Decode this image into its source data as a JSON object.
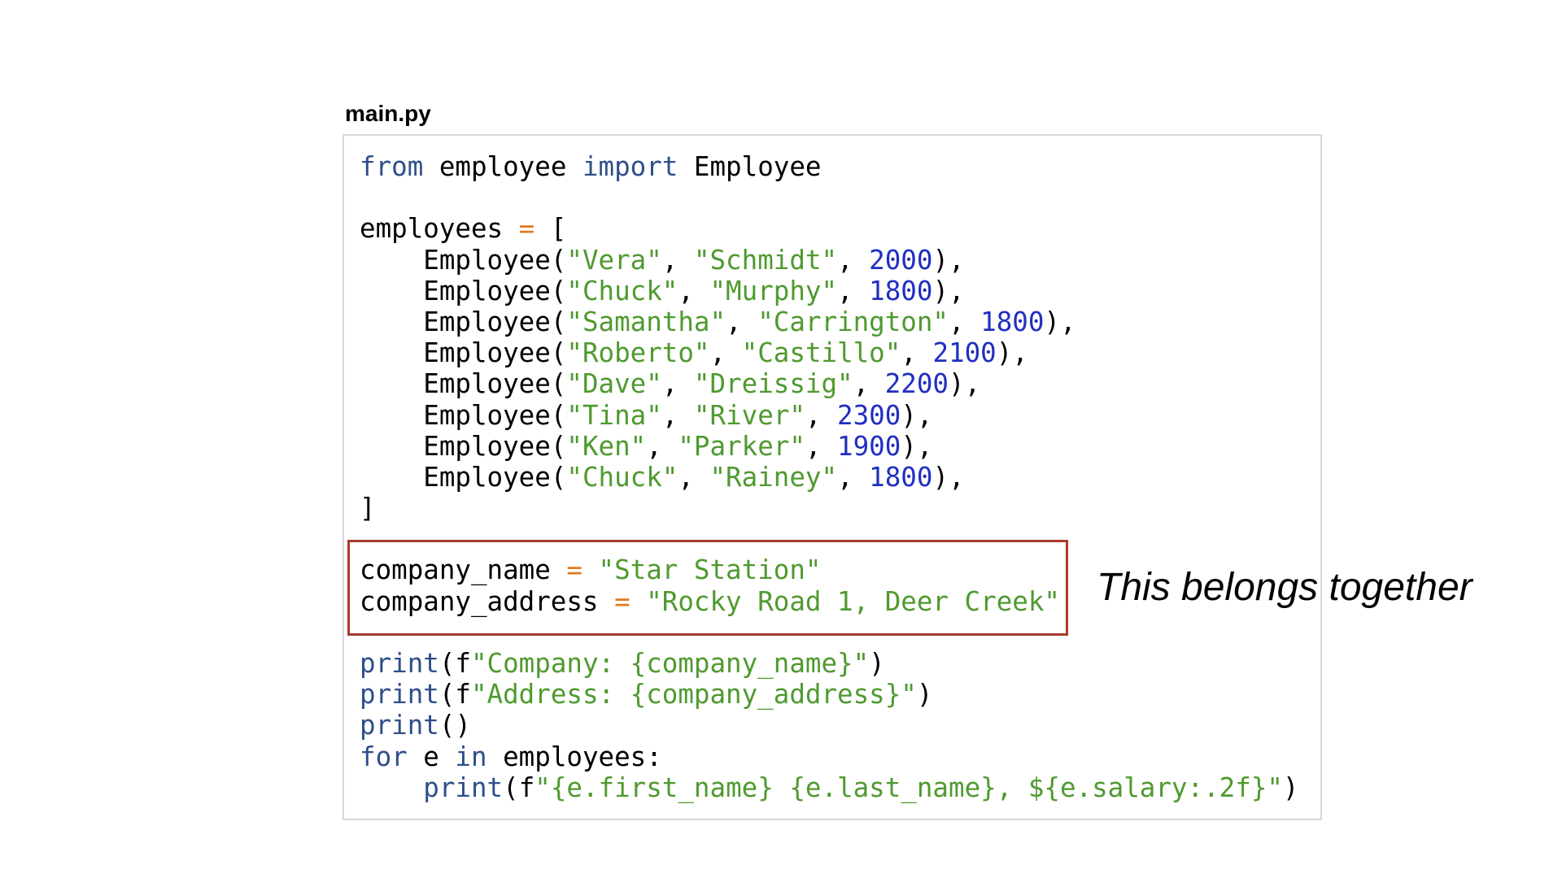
{
  "file_title": "main.py",
  "annotation": "This belongs together",
  "colors": {
    "keyword": "#2f4f8a",
    "string": "#4f9a2f",
    "number": "#1f2fc0",
    "operator": "#e07b1f",
    "highlight_border": "#a83a2c",
    "panel_border": "#d9d9d9"
  },
  "code_lines": [
    [
      [
        "kw",
        "from"
      ],
      [
        "id",
        " employee "
      ],
      [
        "kw",
        "import"
      ],
      [
        "id",
        " Employee"
      ]
    ],
    [],
    [
      [
        "id",
        "employees "
      ],
      [
        "op",
        "="
      ],
      [
        "punc",
        " ["
      ]
    ],
    [
      [
        "id",
        "    Employee("
      ],
      [
        "str",
        "\"Vera\""
      ],
      [
        "punc",
        ", "
      ],
      [
        "str",
        "\"Schmidt\""
      ],
      [
        "punc",
        ", "
      ],
      [
        "num",
        "2000"
      ],
      [
        "punc",
        "),"
      ]
    ],
    [
      [
        "id",
        "    Employee("
      ],
      [
        "str",
        "\"Chuck\""
      ],
      [
        "punc",
        ", "
      ],
      [
        "str",
        "\"Murphy\""
      ],
      [
        "punc",
        ", "
      ],
      [
        "num",
        "1800"
      ],
      [
        "punc",
        "),"
      ]
    ],
    [
      [
        "id",
        "    Employee("
      ],
      [
        "str",
        "\"Samantha\""
      ],
      [
        "punc",
        ", "
      ],
      [
        "str",
        "\"Carrington\""
      ],
      [
        "punc",
        ", "
      ],
      [
        "num",
        "1800"
      ],
      [
        "punc",
        "),"
      ]
    ],
    [
      [
        "id",
        "    Employee("
      ],
      [
        "str",
        "\"Roberto\""
      ],
      [
        "punc",
        ", "
      ],
      [
        "str",
        "\"Castillo\""
      ],
      [
        "punc",
        ", "
      ],
      [
        "num",
        "2100"
      ],
      [
        "punc",
        "),"
      ]
    ],
    [
      [
        "id",
        "    Employee("
      ],
      [
        "str",
        "\"Dave\""
      ],
      [
        "punc",
        ", "
      ],
      [
        "str",
        "\"Dreissig\""
      ],
      [
        "punc",
        ", "
      ],
      [
        "num",
        "2200"
      ],
      [
        "punc",
        "),"
      ]
    ],
    [
      [
        "id",
        "    Employee("
      ],
      [
        "str",
        "\"Tina\""
      ],
      [
        "punc",
        ", "
      ],
      [
        "str",
        "\"River\""
      ],
      [
        "punc",
        ", "
      ],
      [
        "num",
        "2300"
      ],
      [
        "punc",
        "),"
      ]
    ],
    [
      [
        "id",
        "    Employee("
      ],
      [
        "str",
        "\"Ken\""
      ],
      [
        "punc",
        ", "
      ],
      [
        "str",
        "\"Parker\""
      ],
      [
        "punc",
        ", "
      ],
      [
        "num",
        "1900"
      ],
      [
        "punc",
        "),"
      ]
    ],
    [
      [
        "id",
        "    Employee("
      ],
      [
        "str",
        "\"Chuck\""
      ],
      [
        "punc",
        ", "
      ],
      [
        "str",
        "\"Rainey\""
      ],
      [
        "punc",
        ", "
      ],
      [
        "num",
        "1800"
      ],
      [
        "punc",
        "),"
      ]
    ],
    [
      [
        "punc",
        "]"
      ]
    ],
    [],
    [
      [
        "id",
        "company_name "
      ],
      [
        "op",
        "="
      ],
      [
        "str",
        " \"Star Station\""
      ]
    ],
    [
      [
        "id",
        "company_address "
      ],
      [
        "op",
        "="
      ],
      [
        "str",
        " \"Rocky Road 1, Deer Creek\""
      ]
    ],
    [],
    [
      [
        "kw",
        "print"
      ],
      [
        "punc",
        "(f"
      ],
      [
        "str",
        "\"Company: {company_name}\""
      ],
      [
        "punc",
        ")"
      ]
    ],
    [
      [
        "kw",
        "print"
      ],
      [
        "punc",
        "(f"
      ],
      [
        "str",
        "\"Address: {company_address}\""
      ],
      [
        "punc",
        ")"
      ]
    ],
    [
      [
        "kw",
        "print"
      ],
      [
        "punc",
        "()"
      ]
    ],
    [
      [
        "kw",
        "for"
      ],
      [
        "id",
        " e "
      ],
      [
        "kw",
        "in"
      ],
      [
        "id",
        " employees:"
      ]
    ],
    [
      [
        "id",
        "    "
      ],
      [
        "kw",
        "print"
      ],
      [
        "punc",
        "(f"
      ],
      [
        "str",
        "\"{e.first_name} {e.last_name}, ${e.salary:.2f}\""
      ],
      [
        "punc",
        ")"
      ]
    ]
  ]
}
